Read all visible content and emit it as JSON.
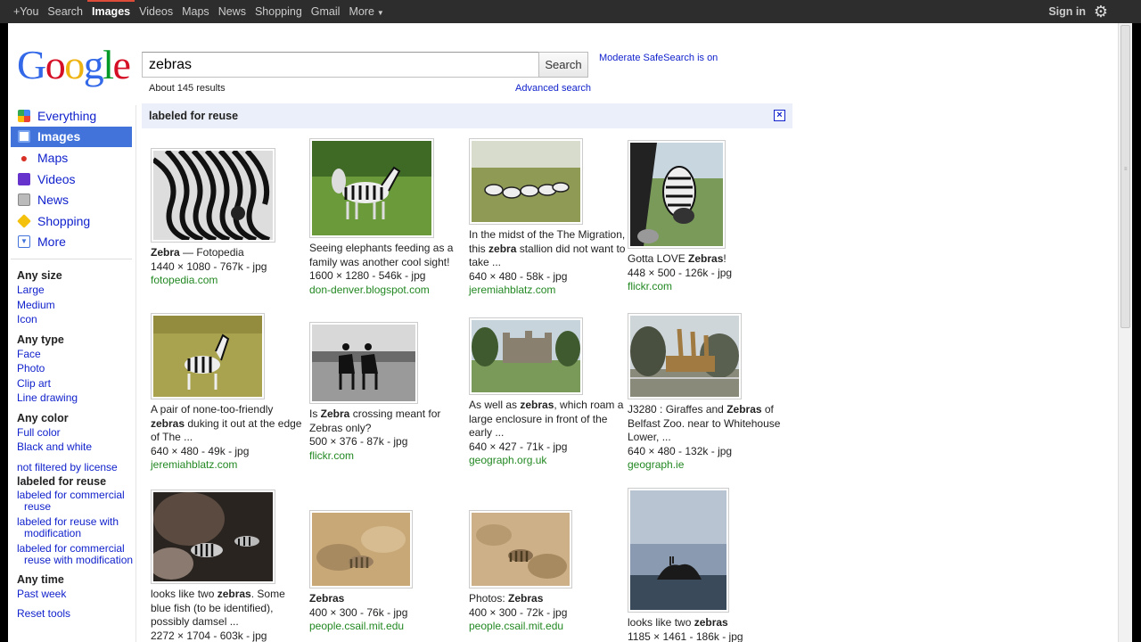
{
  "topbar": {
    "nav": [
      {
        "label": "+You",
        "active": false
      },
      {
        "label": "Search",
        "active": false
      },
      {
        "label": "Images",
        "active": true
      },
      {
        "label": "Videos",
        "active": false
      },
      {
        "label": "Maps",
        "active": false
      },
      {
        "label": "News",
        "active": false
      },
      {
        "label": "Shopping",
        "active": false
      },
      {
        "label": "Gmail",
        "active": false
      },
      {
        "label": "More",
        "active": false
      }
    ],
    "signin": "Sign in",
    "gear_icon": "gear-icon"
  },
  "logo": {
    "letters": [
      "G",
      "o",
      "o",
      "g",
      "l",
      "e"
    ]
  },
  "search": {
    "query": "zebras",
    "button": "Search",
    "safesearch": "Moderate SafeSearch is on",
    "result_count": "About 145 results",
    "advanced": "Advanced search"
  },
  "leftnav": {
    "items": [
      {
        "label": "Everything",
        "icon": "everything-icon",
        "color": "#3a8a2e",
        "selected": false
      },
      {
        "label": "Images",
        "icon": "images-icon",
        "color": "#4273db",
        "selected": true
      },
      {
        "label": "Maps",
        "icon": "map-pin-icon",
        "color": "#d93025",
        "selected": false
      },
      {
        "label": "Videos",
        "icon": "videos-icon",
        "color": "#6633cc",
        "selected": false
      },
      {
        "label": "News",
        "icon": "news-icon",
        "color": "#888888",
        "selected": false
      },
      {
        "label": "Shopping",
        "icon": "shopping-tag-icon",
        "color": "#f4b400",
        "selected": false
      },
      {
        "label": "More",
        "icon": "more-dropdown-icon",
        "color": "#4273db",
        "selected": false
      }
    ]
  },
  "tools": {
    "size": {
      "head": "Any size",
      "links": [
        "Large",
        "Medium",
        "Icon"
      ]
    },
    "type": {
      "head": "Any type",
      "links": [
        "Face",
        "Photo",
        "Clip art",
        "Line drawing"
      ]
    },
    "color": {
      "head": "Any color",
      "links": [
        "Full color",
        "Black and white"
      ]
    },
    "license": {
      "not_filtered": "not filtered by license",
      "reuse": "labeled for reuse",
      "commercial": [
        "labeled for commercial",
        "reuse"
      ],
      "modification": [
        "labeled for reuse with",
        "modification"
      ],
      "commercial_mod": [
        "labeled for commercial",
        "reuse with modification"
      ]
    },
    "time": {
      "head": "Any time",
      "links": [
        "Past week"
      ]
    },
    "reset": "Reset tools"
  },
  "filterbar": {
    "label": "labeled for reuse",
    "close_icon": "close-x-icon"
  },
  "results": [
    {
      "title_pre": "",
      "title_bold": "Zebra",
      "title_post": " — Fotopedia",
      "meta": "1440 × 1080 - 767k - jpg",
      "site": "fotopedia.com"
    },
    {
      "title_pre": "Seeing elephants feeding as a family was another cool sight!",
      "title_bold": "",
      "title_post": "",
      "meta": "1600 × 1280 - 546k - jpg",
      "site": "don-denver.blogspot.com"
    },
    {
      "title_pre": "In the midst of the The Migration, this ",
      "title_bold": "zebra",
      "title_post": " stallion did not want to take ...",
      "meta": "640 × 480 - 58k - jpg",
      "site": "jeremiahblatz.com"
    },
    {
      "title_pre": "Gotta LOVE ",
      "title_bold": "Zebras",
      "title_post": "!",
      "meta": "448 × 500 - 126k - jpg",
      "site": "flickr.com"
    },
    {
      "title_pre": "A pair of none-too-friendly ",
      "title_bold": "zebras",
      "title_post": " duking it out at the edge of The ...",
      "meta": "640 × 480 - 49k - jpg",
      "site": "jeremiahblatz.com"
    },
    {
      "title_pre": "Is ",
      "title_bold": "Zebra",
      "title_post": " crossing meant for Zebras only?",
      "meta": "500 × 376 - 87k - jpg",
      "site": "flickr.com"
    },
    {
      "title_pre": "As well as ",
      "title_bold": "zebras",
      "title_post": ", which roam a large enclosure in front of the early ...",
      "meta": "640 × 427 - 71k - jpg",
      "site": "geograph.org.uk"
    },
    {
      "title_pre": "J3280 : Giraffes and ",
      "title_bold": "Zebras",
      "title_post": " of Belfast Zoo. near to Whitehouse Lower, ...",
      "meta": "640 × 480 - 132k - jpg",
      "site": "geograph.ie"
    },
    {
      "title_pre": "looks like two ",
      "title_bold": "zebras",
      "title_post": ". Some blue fish (to be identified), possibly damsel ...",
      "meta": "2272 × 1704 - 603k - jpg",
      "site": ""
    },
    {
      "title_pre": "",
      "title_bold": "Zebras",
      "title_post": "",
      "meta": "400 × 300 - 76k - jpg",
      "site": "people.csail.mit.edu"
    },
    {
      "title_pre": "Photos: ",
      "title_bold": "Zebras",
      "title_post": "",
      "meta": "400 × 300 - 72k - jpg",
      "site": "people.csail.mit.edu"
    },
    {
      "title_pre": "looks like two ",
      "title_bold": "zebras",
      "title_post": "",
      "meta": "1185 × 1461 - 186k - jpg",
      "site": ""
    }
  ]
}
